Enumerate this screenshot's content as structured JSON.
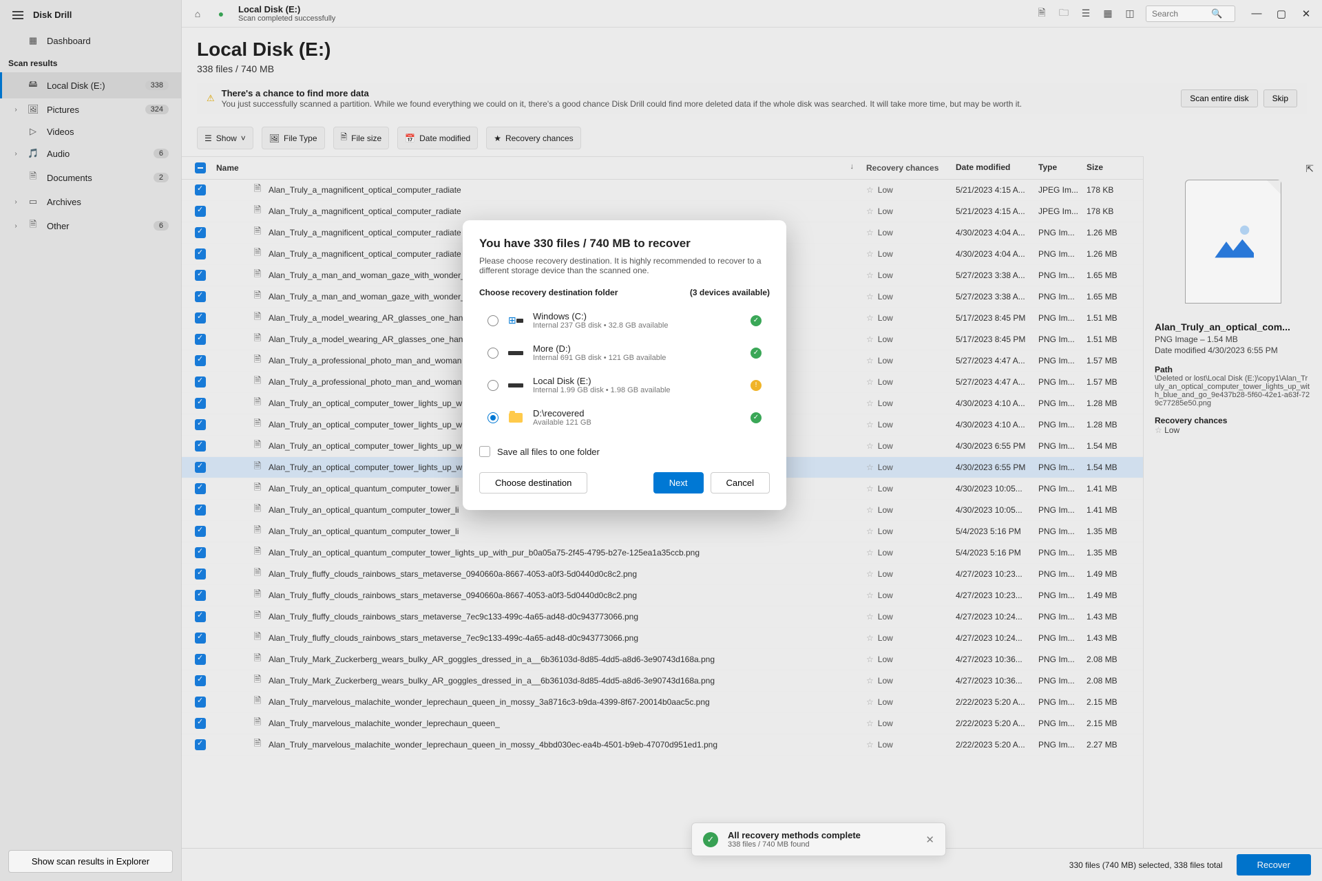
{
  "app": {
    "name": "Disk Drill"
  },
  "sidebar": {
    "dashboard": "Dashboard",
    "scan_results_heading": "Scan results",
    "items": [
      {
        "icon": "🖴",
        "label": "Local Disk (E:)",
        "badge": "338",
        "active": true
      },
      {
        "icon": "🖼",
        "label": "Pictures",
        "badge": "324"
      },
      {
        "icon": "▷",
        "label": "Videos"
      },
      {
        "icon": "🎵",
        "label": "Audio",
        "badge": "6"
      },
      {
        "icon": "🗎",
        "label": "Documents",
        "badge": "2"
      },
      {
        "icon": "▭",
        "label": "Archives"
      },
      {
        "icon": "🗎",
        "label": "Other",
        "badge": "6"
      }
    ],
    "bottom_button": "Show scan results in Explorer"
  },
  "topbar": {
    "title": "Local Disk (E:)",
    "status": "Scan completed successfully",
    "search_placeholder": "Search"
  },
  "title": {
    "heading": "Local Disk (E:)",
    "sub": "338 files / 740 MB"
  },
  "warning": {
    "title": "There's a chance to find more data",
    "text": "You just successfully scanned a partition. While we found everything we could on it, there's a good chance Disk Drill could find more deleted data if the whole disk was searched. It will take more time, but may be worth it.",
    "scan_btn": "Scan entire disk",
    "skip_btn": "Skip"
  },
  "toolbar": {
    "show": "Show",
    "filetype": "File Type",
    "filesize": "File size",
    "datemod": "Date modified",
    "recchance": "Recovery chances"
  },
  "columns": {
    "name": "Name",
    "rec": "Recovery chances",
    "date": "Date modified",
    "type": "Type",
    "size": "Size"
  },
  "rows": [
    {
      "name": "Alan_Truly_a_magnificent_optical_computer_radiate",
      "rec": "Low",
      "date": "5/21/2023 4:15 A...",
      "type": "JPEG Im...",
      "size": "178 KB"
    },
    {
      "name": "Alan_Truly_a_magnificent_optical_computer_radiate",
      "rec": "Low",
      "date": "5/21/2023 4:15 A...",
      "type": "JPEG Im...",
      "size": "178 KB"
    },
    {
      "name": "Alan_Truly_a_magnificent_optical_computer_radiate",
      "rec": "Low",
      "date": "4/30/2023 4:04 A...",
      "type": "PNG Im...",
      "size": "1.26 MB"
    },
    {
      "name": "Alan_Truly_a_magnificent_optical_computer_radiate",
      "rec": "Low",
      "date": "4/30/2023 4:04 A...",
      "type": "PNG Im...",
      "size": "1.26 MB"
    },
    {
      "name": "Alan_Truly_a_man_and_woman_gaze_with_wonder_",
      "rec": "Low",
      "date": "5/27/2023 3:38 A...",
      "type": "PNG Im...",
      "size": "1.65 MB"
    },
    {
      "name": "Alan_Truly_a_man_and_woman_gaze_with_wonder_",
      "rec": "Low",
      "date": "5/27/2023 3:38 A...",
      "type": "PNG Im...",
      "size": "1.65 MB"
    },
    {
      "name": "Alan_Truly_a_model_wearing_AR_glasses_one_hand",
      "rec": "Low",
      "date": "5/17/2023 8:45 PM",
      "type": "PNG Im...",
      "size": "1.51 MB"
    },
    {
      "name": "Alan_Truly_a_model_wearing_AR_glasses_one_hand",
      "rec": "Low",
      "date": "5/17/2023 8:45 PM",
      "type": "PNG Im...",
      "size": "1.51 MB"
    },
    {
      "name": "Alan_Truly_a_professional_photo_man_and_woman",
      "rec": "Low",
      "date": "5/27/2023 4:47 A...",
      "type": "PNG Im...",
      "size": "1.57 MB"
    },
    {
      "name": "Alan_Truly_a_professional_photo_man_and_woman",
      "rec": "Low",
      "date": "5/27/2023 4:47 A...",
      "type": "PNG Im...",
      "size": "1.57 MB"
    },
    {
      "name": "Alan_Truly_an_optical_computer_tower_lights_up_w",
      "rec": "Low",
      "date": "4/30/2023 4:10 A...",
      "type": "PNG Im...",
      "size": "1.28 MB"
    },
    {
      "name": "Alan_Truly_an_optical_computer_tower_lights_up_w",
      "rec": "Low",
      "date": "4/30/2023 4:10 A...",
      "type": "PNG Im...",
      "size": "1.28 MB"
    },
    {
      "name": "Alan_Truly_an_optical_computer_tower_lights_up_w",
      "rec": "Low",
      "date": "4/30/2023 6:55 PM",
      "type": "PNG Im...",
      "size": "1.54 MB"
    },
    {
      "name": "Alan_Truly_an_optical_computer_tower_lights_up_w",
      "rec": "Low",
      "date": "4/30/2023 6:55 PM",
      "type": "PNG Im...",
      "size": "1.54 MB",
      "sel": true
    },
    {
      "name": "Alan_Truly_an_optical_quantum_computer_tower_li",
      "rec": "Low",
      "date": "4/30/2023 10:05...",
      "type": "PNG Im...",
      "size": "1.41 MB"
    },
    {
      "name": "Alan_Truly_an_optical_quantum_computer_tower_li",
      "rec": "Low",
      "date": "4/30/2023 10:05...",
      "type": "PNG Im...",
      "size": "1.41 MB"
    },
    {
      "name": "Alan_Truly_an_optical_quantum_computer_tower_li",
      "rec": "Low",
      "date": "5/4/2023 5:16 PM",
      "type": "PNG Im...",
      "size": "1.35 MB"
    },
    {
      "name": "Alan_Truly_an_optical_quantum_computer_tower_lights_up_with_pur_b0a05a75-2f45-4795-b27e-125ea1a35ccb.png",
      "rec": "Low",
      "date": "5/4/2023 5:16 PM",
      "type": "PNG Im...",
      "size": "1.35 MB"
    },
    {
      "name": "Alan_Truly_fluffy_clouds_rainbows_stars_metaverse_0940660a-8667-4053-a0f3-5d0440d0c8c2.png",
      "rec": "Low",
      "date": "4/27/2023 10:23...",
      "type": "PNG Im...",
      "size": "1.49 MB"
    },
    {
      "name": "Alan_Truly_fluffy_clouds_rainbows_stars_metaverse_0940660a-8667-4053-a0f3-5d0440d0c8c2.png",
      "rec": "Low",
      "date": "4/27/2023 10:23...",
      "type": "PNG Im...",
      "size": "1.49 MB"
    },
    {
      "name": "Alan_Truly_fluffy_clouds_rainbows_stars_metaverse_7ec9c133-499c-4a65-ad48-d0c943773066.png",
      "rec": "Low",
      "date": "4/27/2023 10:24...",
      "type": "PNG Im...",
      "size": "1.43 MB"
    },
    {
      "name": "Alan_Truly_fluffy_clouds_rainbows_stars_metaverse_7ec9c133-499c-4a65-ad48-d0c943773066.png",
      "rec": "Low",
      "date": "4/27/2023 10:24...",
      "type": "PNG Im...",
      "size": "1.43 MB"
    },
    {
      "name": "Alan_Truly_Mark_Zuckerberg_wears_bulky_AR_goggles_dressed_in_a__6b36103d-8d85-4dd5-a8d6-3e90743d168a.png",
      "rec": "Low",
      "date": "4/27/2023 10:36...",
      "type": "PNG Im...",
      "size": "2.08 MB"
    },
    {
      "name": "Alan_Truly_Mark_Zuckerberg_wears_bulky_AR_goggles_dressed_in_a__6b36103d-8d85-4dd5-a8d6-3e90743d168a.png",
      "rec": "Low",
      "date": "4/27/2023 10:36...",
      "type": "PNG Im...",
      "size": "2.08 MB"
    },
    {
      "name": "Alan_Truly_marvelous_malachite_wonder_leprechaun_queen_in_mossy_3a8716c3-b9da-4399-8f67-20014b0aac5c.png",
      "rec": "Low",
      "date": "2/22/2023 5:20 A...",
      "type": "PNG Im...",
      "size": "2.15 MB"
    },
    {
      "name": "Alan_Truly_marvelous_malachite_wonder_leprechaun_queen_",
      "rec": "Low",
      "date": "2/22/2023 5:20 A...",
      "type": "PNG Im...",
      "size": "2.15 MB"
    },
    {
      "name": "Alan_Truly_marvelous_malachite_wonder_leprechaun_queen_in_mossy_4bbd030ec-ea4b-4501-b9eb-47070d951ed1.png",
      "rec": "Low",
      "date": "2/22/2023 5:20 A...",
      "type": "PNG Im...",
      "size": "2.27 MB"
    }
  ],
  "preview": {
    "title": "Alan_Truly_an_optical_com...",
    "meta": "PNG Image – 1.54 MB",
    "date": "Date modified 4/30/2023 6:55 PM",
    "path_label": "Path",
    "path": "\\Deleted or lost\\Local Disk (E:)\\copy1\\Alan_Truly_an_optical_computer_tower_lights_up_with_blue_and_go_9e437b28-5f60-42e1-a63f-729c77285e50.png",
    "rec_label": "Recovery chances",
    "rec": "Low"
  },
  "footer": {
    "summary": "330 files (740 MB) selected, 338 files total",
    "recover": "Recover"
  },
  "modal": {
    "title": "You have 330 files / 740 MB to recover",
    "text": "Please choose recovery destination. It is highly recommended to recover to a different storage device than the scanned one.",
    "choose_h": "Choose recovery destination folder",
    "devcount": "(3 devices available)",
    "dests": [
      {
        "name": "Windows (C:)",
        "sub": "Internal 237 GB disk • 32.8 GB available",
        "status": "ok",
        "icon": "disk",
        "win": true
      },
      {
        "name": "More (D:)",
        "sub": "Internal 691 GB disk • 121 GB available",
        "status": "ok",
        "icon": "disk"
      },
      {
        "name": "Local Disk (E:)",
        "sub": "Internal 1.99 GB disk • 1.98 GB available",
        "status": "warn",
        "icon": "disk"
      },
      {
        "name": "D:\\recovered",
        "sub": "Available 121 GB",
        "status": "ok",
        "icon": "folder",
        "selected": true
      }
    ],
    "save_one": "Save all files to one folder",
    "choose_btn": "Choose destination",
    "next": "Next",
    "cancel": "Cancel"
  },
  "toast": {
    "title": "All recovery methods complete",
    "sub": "338 files / 740 MB found"
  }
}
